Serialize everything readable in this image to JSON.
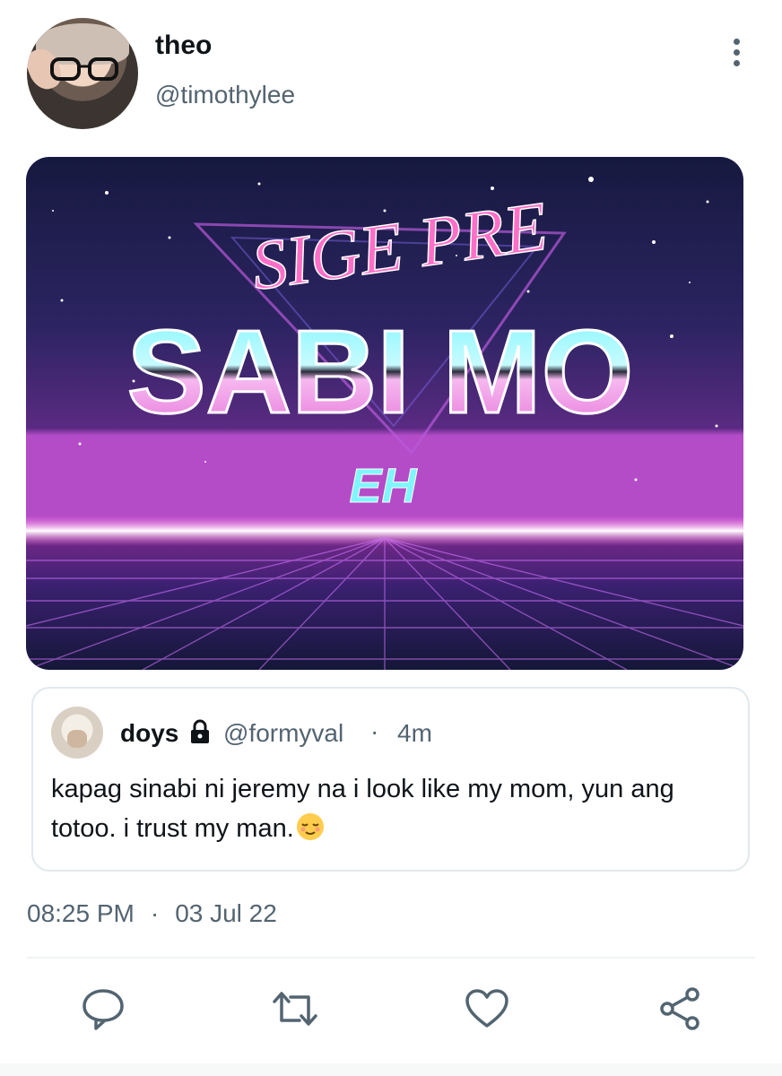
{
  "author": {
    "display_name": "theo",
    "handle": "@timothylee"
  },
  "media": {
    "top_text": "SIGE PRE",
    "main_text": "SABI MO",
    "bottom_text": "EH"
  },
  "quote": {
    "display_name": "doys",
    "handle": "@formyval",
    "separator": "·",
    "time": "4m",
    "text": "kapag sinabi ni jeremy na i look like my mom, yun ang totoo. i trust my man."
  },
  "meta": {
    "time": "08:25 PM",
    "separator": "·",
    "date": "03 Jul 22"
  },
  "actions": [
    "reply-icon",
    "retweet-icon",
    "like-icon",
    "share-icon"
  ],
  "colors": {
    "text": "#0f1419",
    "secondary": "#536471",
    "neon_pink": "#ff6fc8",
    "neon_cyan": "#7ff6ff"
  }
}
